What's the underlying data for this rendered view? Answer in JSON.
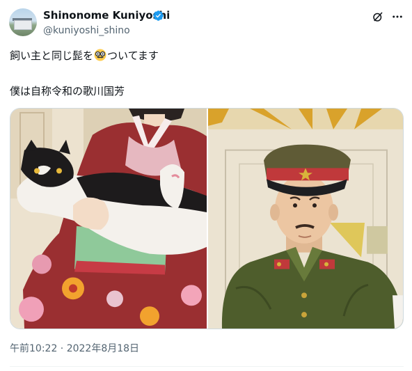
{
  "author": {
    "display_name": "Shinonome Kuniyoshi",
    "handle": "@kuniyoshi_shino",
    "verified": true,
    "badge_color": "#1d9bf0"
  },
  "header_icons": [
    "grok-icon",
    "more-icon"
  ],
  "tweet": {
    "text_line1_before": "飼い主と同じ髭を",
    "text_line1_emoji": "nerd-glasses-mustache-emoji",
    "text_line1_after": "ついてます",
    "text_line2": "僕は自称令和の歌川国芳"
  },
  "media": {
    "images": [
      "kimono-girl-holding-cat-illustration",
      "military-officer-portrait-illustration"
    ]
  },
  "timestamp": "午前10:22 · 2022年8月18日",
  "colors": {
    "text": "#0f1419",
    "secondary": "#536471",
    "border": "#cfd9de"
  }
}
